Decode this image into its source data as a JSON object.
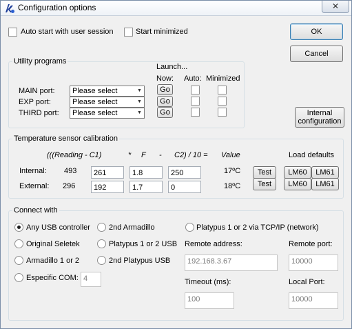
{
  "window": {
    "title": "Configuration options",
    "close_glyph": "✕"
  },
  "startup": {
    "auto_start_label": "Auto start with user session",
    "start_minimized_label": "Start minimized"
  },
  "buttons": {
    "ok": "OK",
    "cancel": "Cancel",
    "internal_configuration_line1": "Internal",
    "internal_configuration_line2": "configuration"
  },
  "utility": {
    "title": "Utility programs",
    "launch_header": "Launch...",
    "now_header": "Now:",
    "auto_header": "Auto:",
    "minimized_header": "Minimized",
    "rows": [
      {
        "label": "MAIN port:",
        "select_value": "Please select",
        "go_label": "Go"
      },
      {
        "label": "EXP port:",
        "select_value": "Please select",
        "go_label": "Go"
      },
      {
        "label": "THIRD port:",
        "select_value": "Please select",
        "go_label": "Go"
      }
    ]
  },
  "temperature": {
    "title": "Temperature sensor calibration",
    "formula": {
      "part1": "(((Reading  -  C1)",
      "part2": "*",
      "part3": "F",
      "part4": "-",
      "part5": "C2) / 10 =",
      "part6": "Value"
    },
    "load_defaults_label": "Load defaults",
    "rows": [
      {
        "label": "Internal:",
        "reading": "493",
        "c1": "261",
        "f": "1.8",
        "c2": "250",
        "value": "17ºC",
        "test_label": "Test",
        "lm60_label": "LM60",
        "lm61_label": "LM61"
      },
      {
        "label": "External:",
        "reading": "296",
        "c1": "192",
        "f": "1.7",
        "c2": "0",
        "value": "18ºC",
        "test_label": "Test",
        "lm60_label": "LM60",
        "lm61_label": "LM61"
      }
    ]
  },
  "connect": {
    "title": "Connect with",
    "options": {
      "any_usb": "Any USB controller",
      "second_armadillo": "2nd Armadillo",
      "platypus_tcp": "Platypus 1 or 2 via TCP/IP (network)",
      "original_seletek": "Original Seletek",
      "platypus_usb": "Platypus 1 or 2 USB",
      "armadillo": "Armadillo 1 or 2",
      "second_platypus_usb": "2nd Platypus USB",
      "especific_com": "Especific COM:"
    },
    "selected": "any_usb",
    "com_value": "4",
    "remote_address_label": "Remote address:",
    "remote_address_value": "192.168.3.67",
    "remote_port_label": "Remote port:",
    "remote_port_value": "10000",
    "timeout_label": "Timeout (ms):",
    "timeout_value": "100",
    "local_port_label": "Local Port:",
    "local_port_value": "10000"
  },
  "icons": {
    "app": "app-logo-icon",
    "dropdown": "chevron-down-icon",
    "close": "close-icon"
  }
}
